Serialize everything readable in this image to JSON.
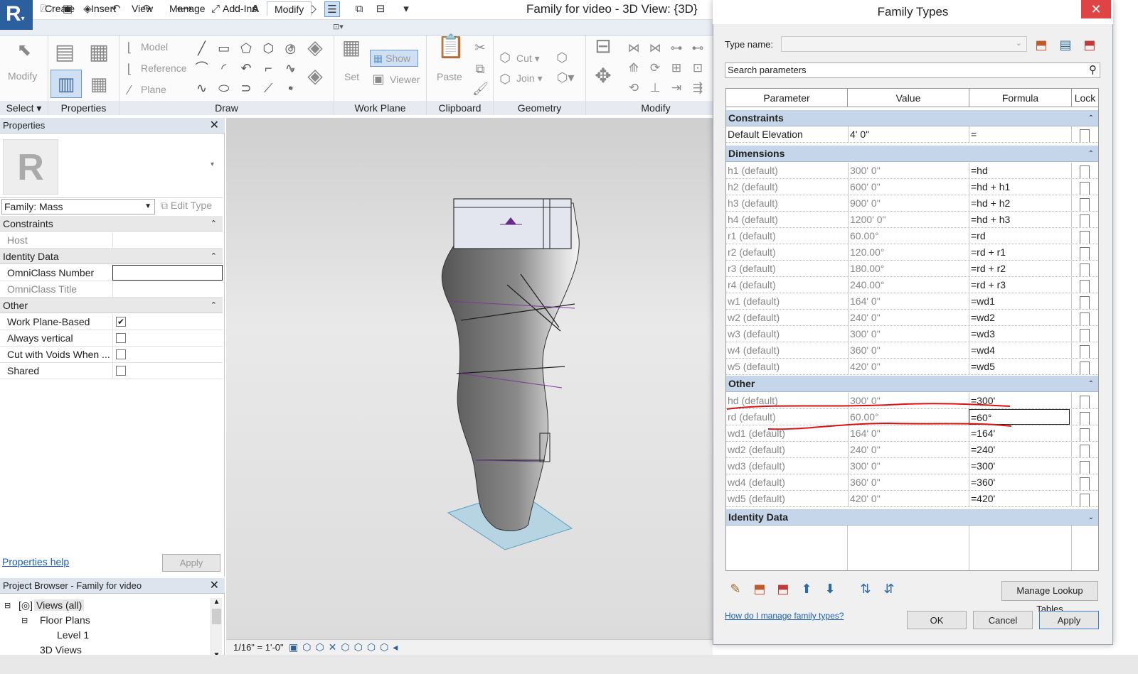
{
  "window": {
    "title": "Family for video - 3D View: {3D}"
  },
  "tabs": [
    "Create",
    "Insert",
    "View",
    "Manage",
    "Add-Ins",
    "Modify"
  ],
  "ribbon": {
    "modify_label": "Modify",
    "select_label": "Select",
    "properties_label": "Properties",
    "draw_label": "Draw",
    "model_label": "Model",
    "reference_label": "Reference",
    "plane_label": "Plane",
    "workplane_label": "Work Plane",
    "set_label": "Set",
    "show_label": "Show",
    "viewer_label": "Viewer",
    "clipboard_label": "Clipboard",
    "paste_label": "Paste",
    "geometry_label": "Geometry",
    "cut_label": "Cut",
    "join_label": "Join",
    "modify_panel_label": "Modify"
  },
  "properties": {
    "header": "Properties",
    "type_selector": "Family: Mass",
    "edit_type": "Edit Type",
    "sections": {
      "constraints": "Constraints",
      "identity": "Identity Data",
      "other": "Other"
    },
    "rows": {
      "host": "Host",
      "omniclass_number": "OmniClass Number",
      "omniclass_title": "OmniClass Title",
      "work_plane_based": "Work Plane-Based",
      "always_vertical": "Always vertical",
      "cut_with_voids": "Cut with Voids When ...",
      "shared": "Shared"
    },
    "help": "Properties help",
    "apply": "Apply"
  },
  "browser": {
    "header": "Project Browser - Family for video",
    "views": "Views (all)",
    "floor_plans": "Floor Plans",
    "level1": "Level 1",
    "views3d": "3D Views"
  },
  "viewbar": {
    "scale": "1/16\" = 1'-0\""
  },
  "dialog": {
    "title": "Family Types",
    "type_name_label": "Type name:",
    "search_placeholder": "Search parameters",
    "columns": [
      "Parameter",
      "Value",
      "Formula",
      "Lock"
    ],
    "sections": {
      "constraints": "Constraints",
      "dimensions": "Dimensions",
      "other": "Other",
      "identity": "Identity Data"
    },
    "constraints_rows": [
      {
        "param": "Default Elevation",
        "value": "4'  0\"",
        "formula": "="
      }
    ],
    "dimension_rows": [
      {
        "param": "h1 (default)",
        "value": "300'  0\"",
        "formula": "=hd"
      },
      {
        "param": "h2 (default)",
        "value": "600'  0\"",
        "formula": "=hd + h1"
      },
      {
        "param": "h3 (default)",
        "value": "900'  0\"",
        "formula": "=hd + h2"
      },
      {
        "param": "h4 (default)",
        "value": "1200'  0\"",
        "formula": "=hd + h3"
      },
      {
        "param": "r1 (default)",
        "value": "60.00°",
        "formula": "=rd"
      },
      {
        "param": "r2 (default)",
        "value": "120.00°",
        "formula": "=rd + r1"
      },
      {
        "param": "r3 (default)",
        "value": "180.00°",
        "formula": "=rd + r2"
      },
      {
        "param": "r4 (default)",
        "value": "240.00°",
        "formula": "=rd + r3"
      },
      {
        "param": "w1 (default)",
        "value": "164'  0\"",
        "formula": "=wd1"
      },
      {
        "param": "w2 (default)",
        "value": "240'  0\"",
        "formula": "=wd2"
      },
      {
        "param": "w3 (default)",
        "value": "300'  0\"",
        "formula": "=wd3"
      },
      {
        "param": "w4 (default)",
        "value": "360'  0\"",
        "formula": "=wd4"
      },
      {
        "param": "w5 (default)",
        "value": "420'  0\"",
        "formula": "=wd5"
      }
    ],
    "other_rows": [
      {
        "param": "hd (default)",
        "value": "300'  0\"",
        "formula": "=300'"
      },
      {
        "param": "rd (default)",
        "value": "60.00°",
        "formula": "=60°"
      },
      {
        "param": "wd1 (default)",
        "value": "164'  0\"",
        "formula": "=164'"
      },
      {
        "param": "wd2 (default)",
        "value": "240'  0\"",
        "formula": "=240'"
      },
      {
        "param": "wd3 (default)",
        "value": "300'  0\"",
        "formula": "=300'"
      },
      {
        "param": "wd4 (default)",
        "value": "360'  0\"",
        "formula": "=360'"
      },
      {
        "param": "wd5 (default)",
        "value": "420'  0\"",
        "formula": "=420'"
      }
    ],
    "manage_lookup": "Manage Lookup Tables",
    "help_link": "How do I manage family types?",
    "ok": "OK",
    "cancel": "Cancel",
    "apply": "Apply"
  },
  "colors": {
    "accent": "#2c5f9e",
    "section": "#c5d6ea",
    "annotation": "#e01010"
  }
}
